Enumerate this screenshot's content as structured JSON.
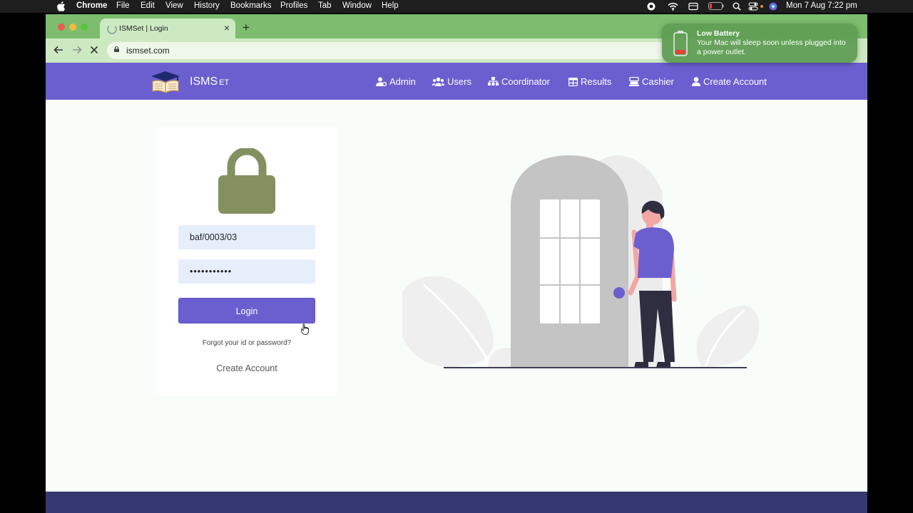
{
  "menubar": {
    "app_name": "Chrome",
    "items": [
      "File",
      "Edit",
      "View",
      "History",
      "Bookmarks",
      "Profiles",
      "Tab",
      "Window",
      "Help"
    ],
    "datetime": "Mon 7 Aug  7:22 pm"
  },
  "browser": {
    "tab_title": "ISMSet | Login",
    "url": "ismset.com"
  },
  "site": {
    "brand": "ISMS",
    "brand_suffix": "ET",
    "nav": [
      "Admin",
      "Users",
      "Coordinator",
      "Results",
      "Cashier",
      "Create Account"
    ],
    "accent_color": "#6b5fd0",
    "footer_color": "#353872"
  },
  "login": {
    "username_value": "baf/0003/03",
    "password_value": "•••••••••••",
    "login_label": "Login",
    "forgot_label": "Forgot your id or password?",
    "create_account_label": "Create Account",
    "lock_color": "#849060"
  },
  "notification": {
    "title": "Low Battery",
    "body": "Your Mac will sleep soon unless plugged into a power outlet."
  }
}
